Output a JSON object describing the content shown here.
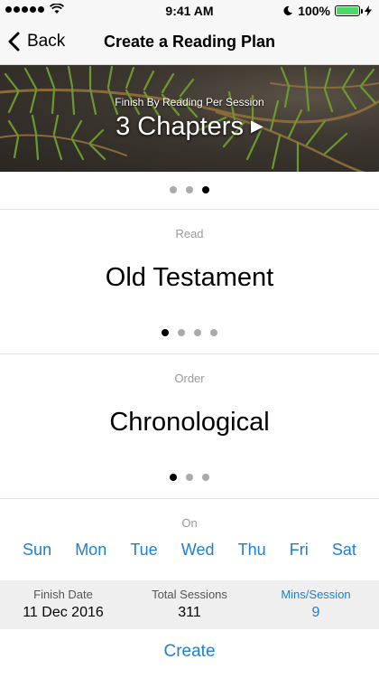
{
  "status_bar": {
    "time": "9:41 AM",
    "battery": "100%"
  },
  "nav": {
    "back_label": "Back",
    "title": "Create a Reading Plan"
  },
  "hero": {
    "subtitle": "Finish By Reading Per Session",
    "value": "3 Chapters",
    "arrow": "▶",
    "pages": 3,
    "active_page": 3
  },
  "read": {
    "label": "Read",
    "value": "Old Testament",
    "pages": 4,
    "active_page": 1
  },
  "order": {
    "label": "Order",
    "value": "Chronological",
    "pages": 3,
    "active_page": 1
  },
  "on": {
    "label": "On",
    "days": [
      "Sun",
      "Mon",
      "Tue",
      "Wed",
      "Thu",
      "Fri",
      "Sat"
    ]
  },
  "summary": {
    "finish_label": "Finish Date",
    "finish_value": "11 Dec 2016",
    "sessions_label": "Total Sessions",
    "sessions_value": "311",
    "mins_label": "Mins/Session",
    "mins_value": "9"
  },
  "create_label": "Create",
  "colors": {
    "accent": "#1e7fcf",
    "battery": "#4cd964"
  }
}
